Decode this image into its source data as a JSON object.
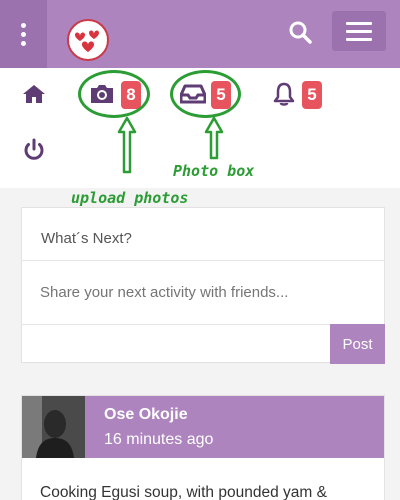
{
  "colors": {
    "primary": "#ad84bd",
    "primary_dark": "#9b72ad",
    "badge": "#e8545e",
    "annotation": "#2c9c34",
    "logo_heart": "#d8343f"
  },
  "topbar": {
    "menu_icon": "vertical-dots-icon",
    "logo_icon": "hearts-logo",
    "search_icon": "search-icon",
    "hamburger_icon": "hamburger-icon"
  },
  "iconbar": {
    "home_icon": "home-icon",
    "camera_badge": "8",
    "inbox_badge": "5",
    "notifications_badge": "5",
    "logout_icon": "power-icon"
  },
  "annotations": {
    "upload": "upload photos",
    "photobox": "Photo box"
  },
  "composer": {
    "title": "What´s Next?",
    "placeholder": "Share your next activity with friends...",
    "post_label": "Post"
  },
  "feed": [
    {
      "name": "Ose Okojie",
      "time": "16 minutes ago",
      "text": "Cooking Egusi soup, with pounded yam &"
    }
  ]
}
